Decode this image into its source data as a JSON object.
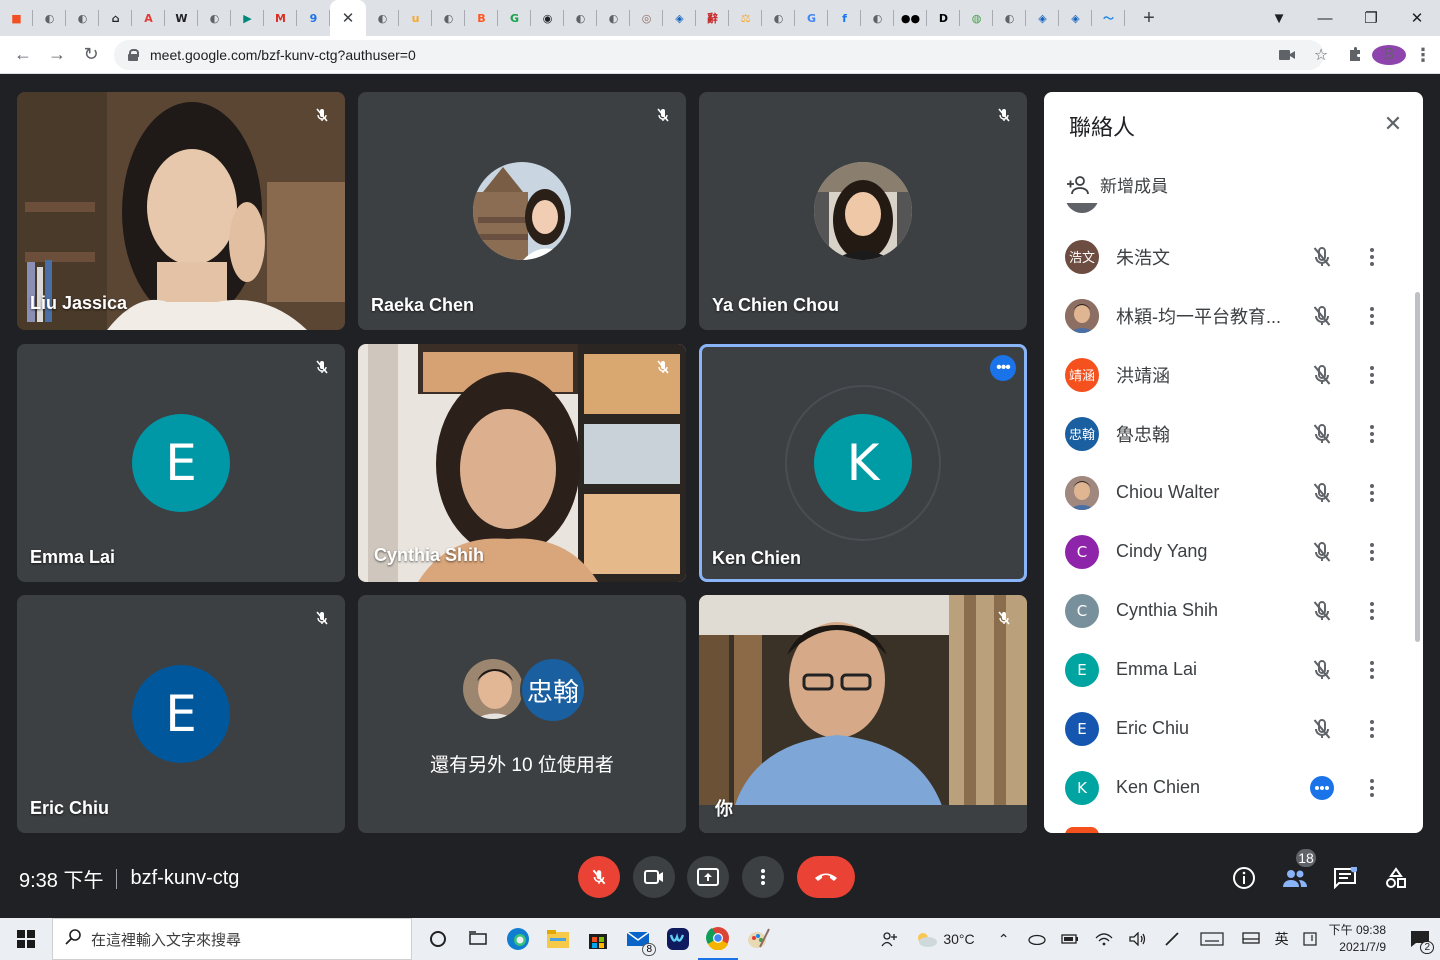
{
  "browser": {
    "tabs": [
      {
        "icon": "windows-icon",
        "color": "#f25022",
        "glyph": "■"
      },
      {
        "icon": "globe-icon",
        "color": "#5f6368",
        "glyph": "◐"
      },
      {
        "icon": "globe-icon",
        "color": "#5f6368",
        "glyph": "◐"
      },
      {
        "icon": "home-icon",
        "color": "#202124",
        "glyph": "⌂"
      },
      {
        "icon": "acrobat-icon",
        "color": "#e53935",
        "glyph": "A"
      },
      {
        "icon": "wikipedia-icon",
        "color": "#202124",
        "glyph": "W"
      },
      {
        "icon": "globe-icon",
        "color": "#5f6368",
        "glyph": "◐"
      },
      {
        "icon": "play-icon",
        "color": "#00897b",
        "glyph": "▶"
      },
      {
        "icon": "gmail-icon",
        "color": "#d93025",
        "glyph": "M"
      },
      {
        "icon": "calendar-icon",
        "color": "#1a73e8",
        "glyph": "9"
      },
      {
        "icon": "globe-icon",
        "color": "#5f6368",
        "glyph": "◐"
      },
      {
        "icon": "ucoin-icon",
        "color": "#f9a825",
        "glyph": "u"
      },
      {
        "icon": "globe-icon",
        "color": "#5f6368",
        "glyph": "◐"
      },
      {
        "icon": "blogger-icon",
        "color": "#ff5722",
        "glyph": "B"
      },
      {
        "icon": "grammarly-icon",
        "color": "#15a34a",
        "glyph": "G"
      },
      {
        "icon": "eye-icon",
        "color": "#202124",
        "glyph": "◉"
      },
      {
        "icon": "globe-icon",
        "color": "#5f6368",
        "glyph": "◐"
      },
      {
        "icon": "globe-icon",
        "color": "#5f6368",
        "glyph": "◐"
      },
      {
        "icon": "swirl-icon",
        "color": "#8d6e63",
        "glyph": "◎"
      },
      {
        "icon": "chat-icon",
        "color": "#1565c0",
        "glyph": "◈"
      },
      {
        "icon": "dictionary-icon",
        "color": "#c62828",
        "glyph": "辭"
      },
      {
        "icon": "scale-icon",
        "color": "#f9a825",
        "glyph": "⚖"
      },
      {
        "icon": "globe-icon",
        "color": "#5f6368",
        "glyph": "◐"
      },
      {
        "icon": "google-icon",
        "color": "#4285f4",
        "glyph": "G"
      },
      {
        "icon": "facebook-icon",
        "color": "#1877f2",
        "glyph": "f"
      },
      {
        "icon": "globe-icon",
        "color": "#5f6368",
        "glyph": "◐"
      },
      {
        "icon": "medium-icon",
        "color": "#000000",
        "glyph": "●●"
      },
      {
        "icon": "dlink-icon",
        "color": "#000000",
        "glyph": "D"
      },
      {
        "icon": "world-icon",
        "color": "#43a047",
        "glyph": "◍"
      },
      {
        "icon": "globe-icon",
        "color": "#5f6368",
        "glyph": "◐"
      },
      {
        "icon": "chat-icon",
        "color": "#1565c0",
        "glyph": "◈"
      },
      {
        "icon": "chat-icon",
        "color": "#1565c0",
        "glyph": "◈"
      },
      {
        "icon": "analytics-icon",
        "color": "#1e88e5",
        "glyph": "〜"
      }
    ],
    "url": "meet.google.com/bzf-kunv-ctg?authuser=0",
    "profile_initial": "B"
  },
  "tiles": [
    {
      "name": "Liu Jassica",
      "type": "video"
    },
    {
      "name": "Raeka Chen",
      "type": "photo"
    },
    {
      "name": "Ya Chien Chou",
      "type": "photo"
    },
    {
      "name": "Emma Lai",
      "type": "initial",
      "initial": "E",
      "color": "#0097a7"
    },
    {
      "name": "Cynthia Shih",
      "type": "video"
    },
    {
      "name": "Ken Chien",
      "type": "initial",
      "initial": "K",
      "color": "#009ca6",
      "speaking": true
    },
    {
      "name": "Eric Chiu",
      "type": "initial",
      "initial": "E",
      "color": "#01579b"
    },
    {
      "type": "others",
      "others_text": "還有另外 10 位使用者",
      "badge_text": "忠翰",
      "badge_color": "#1a5fa0"
    },
    {
      "name": "你",
      "type": "video"
    }
  ],
  "panel": {
    "title": "聯絡人",
    "add_member": "新增成員",
    "people": [
      {
        "name": "朱浩文",
        "avatar_text": "浩文",
        "avatar_color": "#6d4c41",
        "state": "muted"
      },
      {
        "name": "林穎-均一平台教育...",
        "avatar_text": "",
        "avatar_color": "#8d6e63",
        "state": "muted",
        "photo": true
      },
      {
        "name": "洪靖涵",
        "avatar_text": "靖涵",
        "avatar_color": "#f4511e",
        "state": "muted"
      },
      {
        "name": "魯忠翰",
        "avatar_text": "忠翰",
        "avatar_color": "#1a5fa0",
        "state": "muted"
      },
      {
        "name": "Chiou Walter",
        "avatar_text": "",
        "avatar_color": "#a1887f",
        "state": "muted",
        "photo": true
      },
      {
        "name": "Cindy Yang",
        "avatar_text": "C",
        "avatar_color": "#8e24aa",
        "state": "muted"
      },
      {
        "name": "Cynthia Shih",
        "avatar_text": "C",
        "avatar_color": "#78909c",
        "state": "muted"
      },
      {
        "name": "Emma Lai",
        "avatar_text": "E",
        "avatar_color": "#00a4a0",
        "state": "muted"
      },
      {
        "name": "Eric Chiu",
        "avatar_text": "E",
        "avatar_color": "#1557b0",
        "state": "muted"
      },
      {
        "name": "Ken Chien",
        "avatar_text": "K",
        "avatar_color": "#00a4a0",
        "state": "speaking"
      }
    ]
  },
  "meeting": {
    "time": "9:38 下午",
    "code": "bzf-kunv-ctg",
    "participant_count": "18"
  },
  "taskbar": {
    "search_placeholder": "在這裡輸入文字來搜尋",
    "mail_badge": "8",
    "weather": "30°C",
    "ime": "英",
    "clock_time": "下午 09:38",
    "clock_date": "2021/7/9",
    "notification_count": "2"
  }
}
